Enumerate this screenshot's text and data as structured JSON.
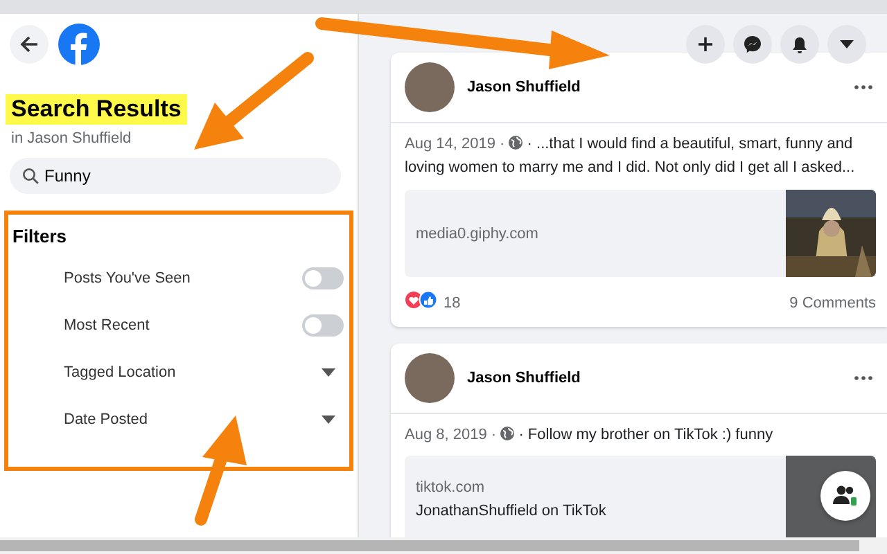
{
  "title": {
    "text": "Search Results",
    "highlighted": true
  },
  "subtitle": "in Jason Shuffield",
  "search": {
    "value": "Funny"
  },
  "filters": {
    "heading": "Filters",
    "items": [
      {
        "label": "Posts You've Seen",
        "kind": "toggle",
        "on": false
      },
      {
        "label": "Most Recent",
        "kind": "toggle",
        "on": false
      },
      {
        "label": "Tagged Location",
        "kind": "dropdown"
      },
      {
        "label": "Date Posted",
        "kind": "dropdown"
      }
    ]
  },
  "posts": [
    {
      "author": "Jason Shuffield",
      "date": "Aug 14, 2019 ·",
      "text": [
        "· ...that I would find a beautiful, smart, funny and",
        "loving women to marry me and I did. Not only did I get all I asked..."
      ],
      "link": {
        "domain": "media0.giphy.com"
      },
      "reactions_count": "18",
      "comments": "9 Comments"
    },
    {
      "author": "Jason Shuffield",
      "date": "Aug 8, 2019 ·",
      "text": [
        "· Follow my brother on TikTok :) funny"
      ],
      "link": {
        "domain": "tiktok.com",
        "title": "JonathanShuffield on TikTok",
        "thumbnail": {
          "kind": "blank"
        }
      }
    }
  ]
}
